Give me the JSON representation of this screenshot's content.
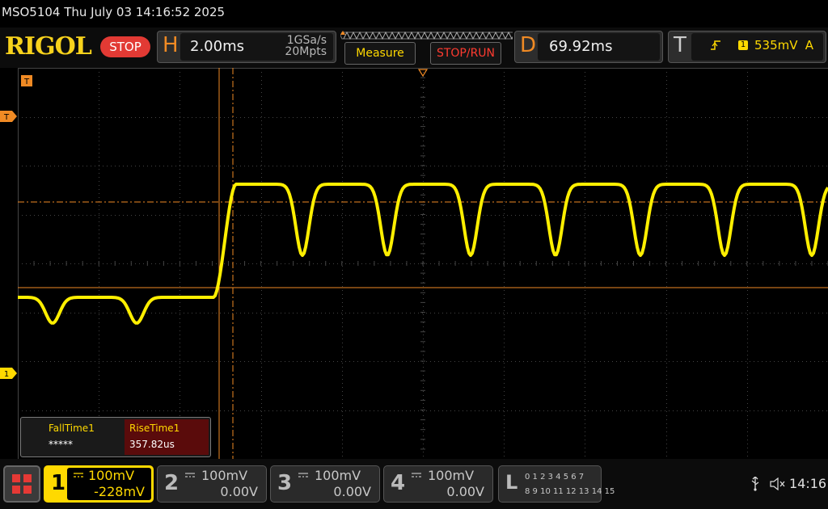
{
  "status": {
    "title": "MSO5104  Thu July 03 14:16:52 2025"
  },
  "topbar": {
    "logo": "RIGOL",
    "run_state": "STOP",
    "horizontal": {
      "letter": "H",
      "timebase": "2.00ms",
      "sample_rate": "1GSa/s",
      "memory_depth": "20Mpts"
    },
    "measure_label": "Measure",
    "stop_run_label": "STOP/RUN",
    "delay": {
      "letter": "D",
      "value": "69.92ms"
    },
    "trigger": {
      "letter": "T",
      "source": "1",
      "level": "535mV",
      "mode": "A"
    }
  },
  "markers": {
    "trigger_pos": "T",
    "trigger_level": "T",
    "ch1_ground": "1"
  },
  "measurements": [
    {
      "name": "FallTime1",
      "value": "*****"
    },
    {
      "name": "RiseTime1",
      "value": "357.82us"
    }
  ],
  "channels": [
    {
      "num": "1",
      "scale": "100mV",
      "offset": "-228mV",
      "active": true
    },
    {
      "num": "2",
      "scale": "100mV",
      "offset": "0.00V",
      "active": false
    },
    {
      "num": "3",
      "scale": "100mV",
      "offset": "0.00V",
      "active": false
    },
    {
      "num": "4",
      "scale": "100mV",
      "offset": "0.00V",
      "active": false
    }
  ],
  "logic": {
    "letter": "L",
    "row1": "0 1 2 3   4 5 6 7",
    "row2": "8 9 10 11  12 13 14 15"
  },
  "clock": "14:16",
  "colors": {
    "trace": "#ffef00",
    "accent": "#f08a24",
    "grid": "#3a3a3a",
    "stop": "#e23a34"
  },
  "icons": [
    "usb-icon",
    "speaker-icon",
    "menu-icon"
  ]
}
